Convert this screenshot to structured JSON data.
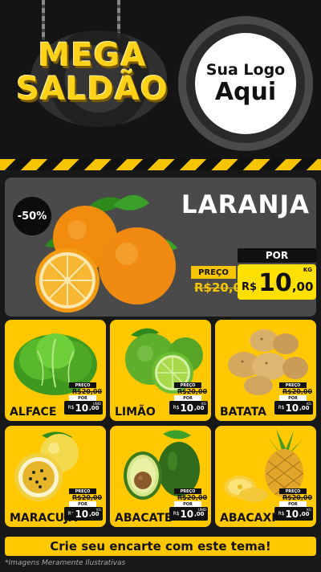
{
  "header": {
    "title_line1": "MEGA",
    "title_line2": "SALDÃO",
    "logo_line1": "Sua Logo",
    "logo_line2": "Aqui"
  },
  "featured": {
    "discount": "-50%",
    "name": "LARANJA",
    "por_label": "POR",
    "preco_label": "PREÇO",
    "old_price": "R$20,00",
    "currency": "R$",
    "price_int": "10",
    "price_dec": ",00",
    "unit": "KG"
  },
  "products": [
    {
      "name": "ALFACE",
      "preco_label": "PREÇO",
      "old_price": "R$20,00",
      "por_label": "POR",
      "currency": "R$",
      "price_int": "10",
      "price_dec": ",00",
      "unit": "UNID"
    },
    {
      "name": "LIMÃO",
      "preco_label": "PREÇO",
      "old_price": "R$20,00",
      "por_label": "POR",
      "currency": "R$",
      "price_int": "10",
      "price_dec": ",00",
      "unit": "KG"
    },
    {
      "name": "BATATA",
      "preco_label": "PREÇO",
      "old_price": "R$20,00",
      "por_label": "POR",
      "currency": "R$",
      "price_int": "10",
      "price_dec": ",00",
      "unit": "KG"
    },
    {
      "name": "MARACUJÁ",
      "preco_label": "PREÇO",
      "old_price": "R$20,00",
      "por_label": "POR",
      "currency": "R$",
      "price_int": "10",
      "price_dec": ",00",
      "unit": "KG"
    },
    {
      "name": "ABACATE",
      "preco_label": "PREÇO",
      "old_price": "R$20,00",
      "por_label": "POR",
      "currency": "R$",
      "price_int": "10",
      "price_dec": ",00",
      "unit": "UNID"
    },
    {
      "name": "ABACAXI",
      "preco_label": "PREÇO",
      "old_price": "R$20,00",
      "por_label": "POR",
      "currency": "R$",
      "price_int": "10",
      "price_dec": ",00",
      "unit": "KG"
    }
  ],
  "footer": {
    "cta": "Crie seu encarte com este tema!",
    "disclaimer": "*Imagens Meramente Ilustrativas"
  },
  "colors": {
    "accent_yellow": "#ffc800",
    "price_yellow": "#ffe000",
    "dark": "#141414"
  }
}
